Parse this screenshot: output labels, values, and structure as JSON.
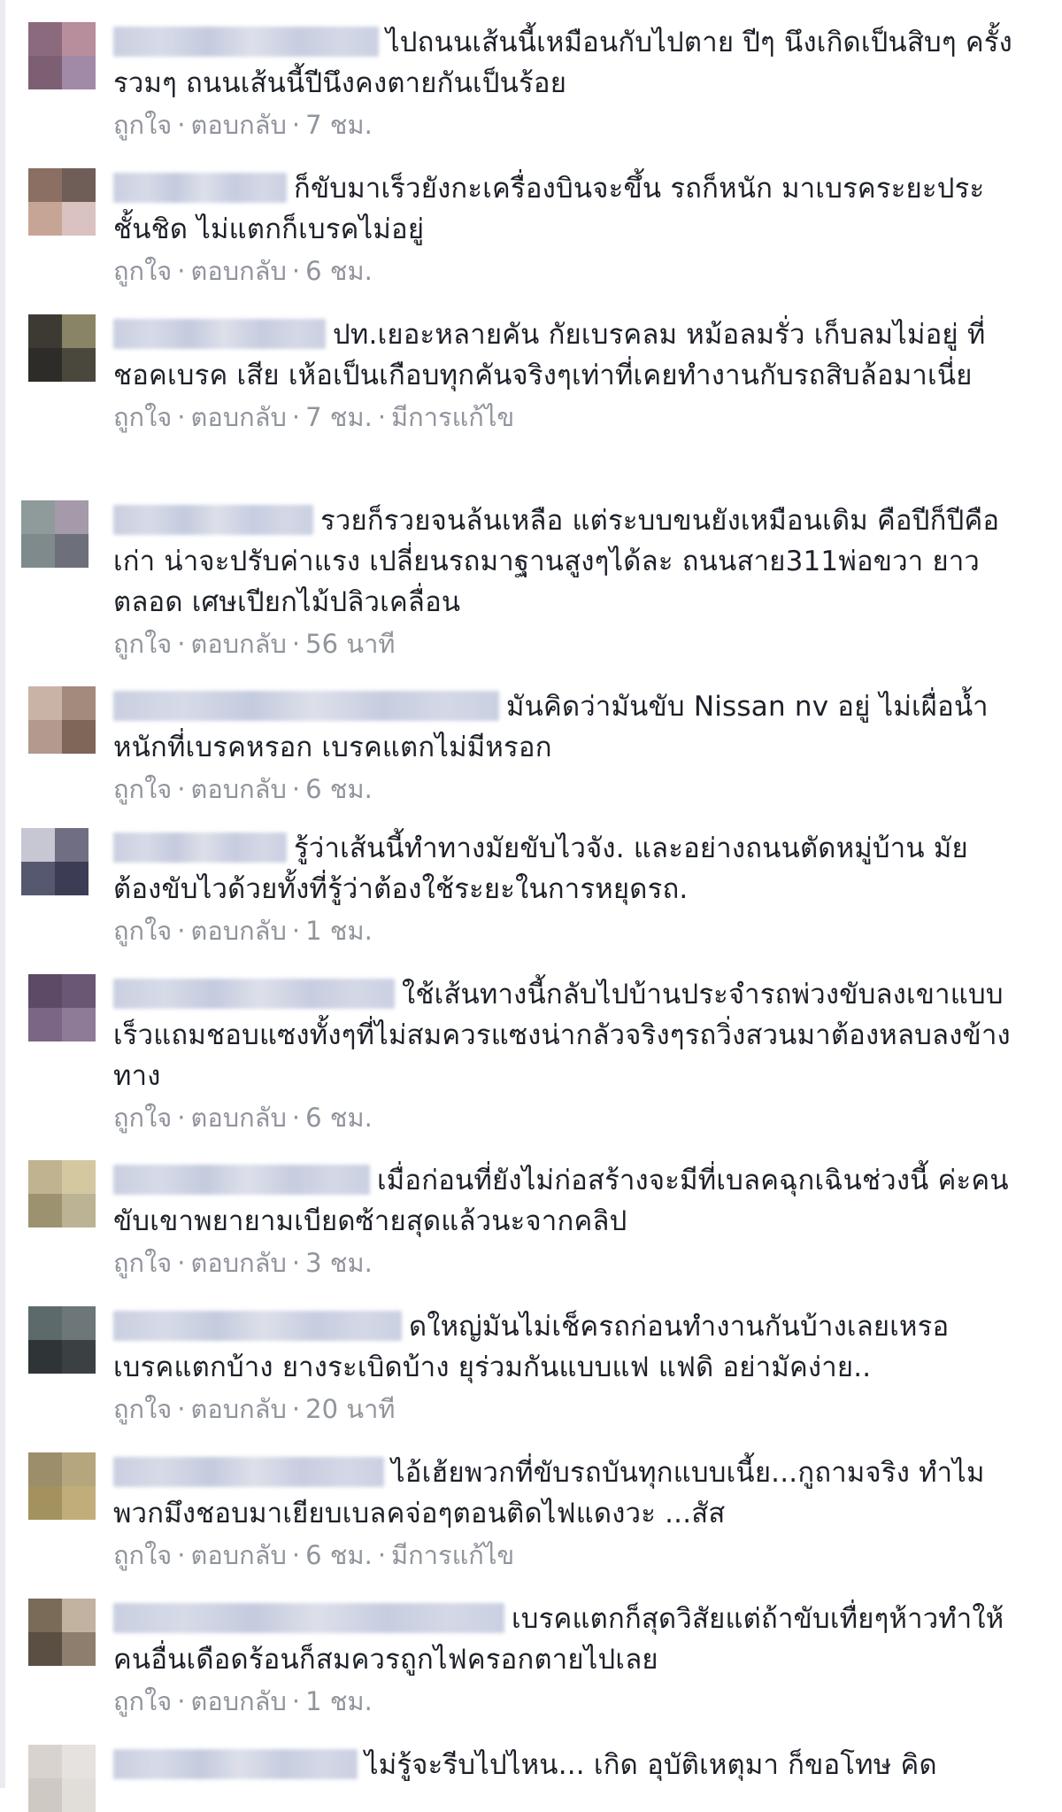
{
  "actions": {
    "like": "ถูกใจ",
    "reply": "ตอบกลับ",
    "separator": "·"
  },
  "comments": [
    {
      "text": "ไปถนนเส้นนี้เหมือนกับไปตาย ปีๆ นึงเกิดเป็นสิบๆ ครั้งรวมๆ ถนนเส้นนี้ปีนึงคงตายกันเป็นร้อย",
      "time": "7 ชม.",
      "edited": "",
      "avatar": [
        "#8c6a7e",
        "#b88d9c",
        "#7d5f74",
        "#a08aa8"
      ]
    },
    {
      "text": "ก็ขับมาเร็วยังกะเครื่องบินจะขึ้น รถก็หนัก มาเบรคระยะประชั้นชิด ไม่แตกก็เบรคไม่อยู่",
      "time": "6 ชม.",
      "edited": "",
      "avatar": [
        "#8a6f62",
        "#6f5e58",
        "#c7a596",
        "#d9c2bf"
      ]
    },
    {
      "text": "ปท.เยอะหลายคัน กัยเบรคลม หม้อลมรั่ว เก็บลมไม่อยู่ ที่ชอคเบรค เสีย เห้อเป็นเกือบทุกคันจริงๆเท่าที่เคยทำงานกับรถสิบล้อมาเนี่ย",
      "time": "7 ชม.",
      "edited": "มีการแก้ไข",
      "avatar": [
        "#3d3a33",
        "#8a8466",
        "#2e2c28",
        "#4a473d"
      ]
    },
    {
      "text": "รวยก็รวยจนล้นเหลือ แต่ระบบขนยังเหมือนเดิม คือปีก็ปีคือเก่า น่าจะปรับค่าแรง เปลี่ยนรถมาฐานสูงๆได้ละ ถนนสาย311พ่อขวา ยาวตลอด เศษเปียกไม้ปลิวเคลื่อน",
      "time": "56 นาที",
      "edited": "",
      "avatar": [
        "#8f9a9b",
        "#a59aa9",
        "#7e8a8c",
        "#6d6f7a"
      ]
    },
    {
      "text": "มันคิดว่ามันขับ Nissan nv อยู่ ไม่เผื่อน้ำหนักที่เบรคหรอก เบรคแตกไม่มีหรอก",
      "time": "6 ชม.",
      "edited": "",
      "avatar": [
        "#c9b3a6",
        "#a48a7d",
        "#b39a8f",
        "#7f6659"
      ]
    },
    {
      "text": "รู้ว่าเส้นนี้ทำทางมัยขับไวจัง. และอย่างถนนตัดหมู่บ้าน มัยต้องขับไวด้วยทั้งที่รู้ว่าต้องใช้ระยะในการหยุดรถ.",
      "time": "1 ชม.",
      "edited": "",
      "avatar": [
        "#c6c7d2",
        "#6f6e82",
        "#56586f",
        "#3c3d55"
      ]
    },
    {
      "text": "ใช้เส้นทางนี้กลับไปบ้านประจำรถพ่วงขับลงเขาแบบเร็วแถมชอบแซงทั้งๆที่ไม่สมควรแซงน่ากลัวจริงๆรถวิ่งสวนมาต้องหลบลงข้างทาง",
      "time": "6 ชม.",
      "edited": "",
      "avatar": [
        "#5c4a66",
        "#6a5775",
        "#7b6686",
        "#8e7b97"
      ]
    },
    {
      "text": "เมื่อก่อนที่ยังไม่ก่อสร้างจะมีที่เบลคฉุกเฉินช่วงนี้ ค่ะคนขับเขาพยายามเบียดซ้ายสุดแล้วนะจากคลิป",
      "time": "3 ชม.",
      "edited": "",
      "avatar": [
        "#bfb48f",
        "#d3c8a0",
        "#9c9270",
        "#bcb395"
      ]
    },
    {
      "text": "ดใหญ่มันไม่เช็ครถก่อนทำงานกันบ้างเลยเหรอ เบรคแตกบ้าง ยางระเบิดบ้าง ยุร่วมกันแบบแฟ แฟดิ อย่ามัคง่าย..",
      "time": "20 นาที",
      "edited": "",
      "avatar": [
        "#5d6a6c",
        "#6d7679",
        "#2f3436",
        "#3b4043"
      ]
    },
    {
      "text": "ไอ้เฮ้ยพวกที่ขับรถบันทุกแบบเนี้ย...กูถามจริง ทำไมพวกมึงชอบมาเยียบเบลคจ่อๆตอนติดไฟแดงวะ ...สัส",
      "time": "6 ชม.",
      "edited": "มีการแก้ไข",
      "avatar": [
        "#9c8d6b",
        "#b5a67e",
        "#a3925e",
        "#c0ad79"
      ]
    },
    {
      "text": "เบรคแตกก็สุดวิสัยแต่ถ้าขับเทื่ยๆห้าวทำให้คนอื่นเดือดร้อนก็สมควรถูกไฟครอกตายไปเลย",
      "time": "1 ชม.",
      "edited": "",
      "avatar": [
        "#7a6a58",
        "#c1b3a0",
        "#5b4f43",
        "#8d7e6d"
      ]
    },
    {
      "text": "ไม่รู้จะรีบไปไหน... เกิด อุบัติเหตุมา ก็ขอโทษ คิด",
      "time": "",
      "edited": "",
      "avatar": [
        "#d8d3cf",
        "#e6e2df",
        "#cfc9c4",
        "#e1ddd9"
      ]
    }
  ]
}
